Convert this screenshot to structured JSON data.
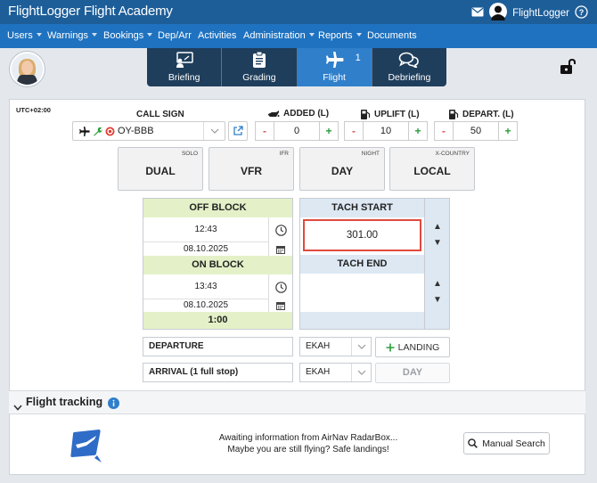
{
  "header": {
    "brand": "FlightLogger Flight Academy",
    "user_name": "FlightLogger"
  },
  "nav": {
    "items": [
      {
        "label": "Users",
        "dropdown": true
      },
      {
        "label": "Warnings",
        "dropdown": true
      },
      {
        "label": "Bookings",
        "dropdown": true
      },
      {
        "label": "Dep/Arr",
        "dropdown": false
      },
      {
        "label": "Activities",
        "dropdown": false
      },
      {
        "label": "Administration",
        "dropdown": true
      },
      {
        "label": "Reports",
        "dropdown": true
      },
      {
        "label": "Documents",
        "dropdown": false
      }
    ]
  },
  "tabs": [
    {
      "label": "Briefing",
      "icon": "briefing-icon"
    },
    {
      "label": "Grading",
      "icon": "clipboard-icon"
    },
    {
      "label": "Flight",
      "icon": "airplane-icon",
      "count": "1",
      "active": true
    },
    {
      "label": "Debriefing",
      "icon": "speech-bubbles-icon"
    }
  ],
  "form": {
    "timezone": "UTC+02:00",
    "call_sign": {
      "label": "CALL SIGN",
      "value": "OY-BBB"
    },
    "added": {
      "label": "ADDED (L)",
      "value": "0"
    },
    "uplift": {
      "label": "UPLIFT (L)",
      "value": "10"
    },
    "depart": {
      "label": "DEPART. (L)",
      "value": "50"
    },
    "minus": "-",
    "plus": "+",
    "options": [
      {
        "small": "SOLO",
        "big": "DUAL"
      },
      {
        "small": "IFR",
        "big": "VFR"
      },
      {
        "small": "NIGHT",
        "big": "DAY"
      },
      {
        "small": "X-COUNTRY",
        "big": "LOCAL"
      }
    ],
    "off_block": {
      "label": "OFF BLOCK",
      "time": "12:43",
      "date": "08.10.2025"
    },
    "on_block": {
      "label": "ON BLOCK",
      "time": "13:43",
      "date": "08.10.2025"
    },
    "block_total": "1:00",
    "tach_start": {
      "label": "TACH START",
      "value": "301.00"
    },
    "tach_end": {
      "label": "TACH END",
      "value": ""
    },
    "departure": {
      "label": "DEPARTURE",
      "airport": "EKAH"
    },
    "arrival": {
      "label": "ARRIVAL (1 full stop)",
      "airport": "EKAH"
    },
    "landing_button": "LANDING",
    "day_button": "DAY"
  },
  "flight_tracking": {
    "title": "Flight tracking",
    "message_line1": "Awaiting information from AirNav RadarBox...",
    "message_line2": "Maybe you are still flying? Safe landings!",
    "manual_search": "Manual Search"
  },
  "colors": {
    "topbar": "#1d5e99",
    "navbar": "#1f72c0",
    "tabs": "#1f3e5c",
    "active_tab": "#2f7fca",
    "block_green": "#e4f1c8",
    "tach_blue": "#dde8f3",
    "highlight": "#e04a3f"
  }
}
